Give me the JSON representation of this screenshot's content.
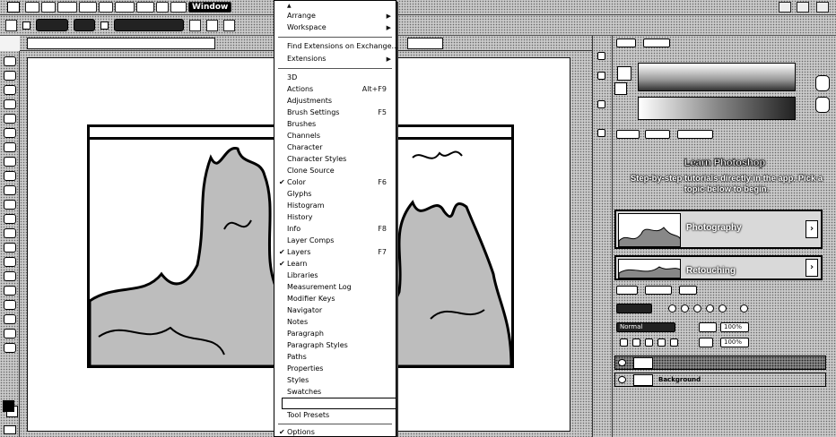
{
  "menubar": {
    "items": [
      "",
      "",
      "",
      "",
      "",
      "",
      "",
      ""
    ],
    "active": "Window"
  },
  "dropdown": {
    "items": [
      {
        "label": "Arrange",
        "submenu": true
      },
      {
        "label": "Workspace",
        "submenu": true
      },
      {
        "label": "Find Extensions on Exchange..."
      },
      {
        "label": "Extensions",
        "submenu": true
      },
      {
        "label": "3D"
      },
      {
        "label": "Actions",
        "shortcut": "Alt+F9"
      },
      {
        "label": "Adjustments"
      },
      {
        "label": "Brush Settings",
        "shortcut": "F5"
      },
      {
        "label": "Brushes"
      },
      {
        "label": "Channels"
      },
      {
        "label": "Character"
      },
      {
        "label": "Character Styles"
      },
      {
        "label": "Clone Source"
      },
      {
        "label": "Color",
        "shortcut": "F6",
        "checked": true
      },
      {
        "label": "Glyphs"
      },
      {
        "label": "Histogram"
      },
      {
        "label": "History"
      },
      {
        "label": "Info",
        "shortcut": "F8"
      },
      {
        "label": "Layer Comps"
      },
      {
        "label": "Layers",
        "shortcut": "F7",
        "checked": true
      },
      {
        "label": "Learn",
        "checked": true
      },
      {
        "label": "Libraries"
      },
      {
        "label": "Measurement Log"
      },
      {
        "label": "Modifier Keys"
      },
      {
        "label": "Navigator"
      },
      {
        "label": "Notes"
      },
      {
        "label": "Paragraph"
      },
      {
        "label": "Paragraph Styles"
      },
      {
        "label": "Paths"
      },
      {
        "label": "Properties"
      },
      {
        "label": "Styles"
      },
      {
        "label": "Swatches"
      },
      {
        "label": ""
      },
      {
        "label": "Tool Presets"
      },
      {
        "label": "Options",
        "checked": true
      }
    ]
  },
  "learn": {
    "title": "Learn Photoshop",
    "subtitle": "Step-by-step tutorials directly in the app. Pick a topic below to begin.",
    "tutorials": [
      {
        "label": "Photography"
      },
      {
        "label": "Retouching"
      }
    ]
  },
  "layers": {
    "blend_mode": "Normal",
    "opacity": "100%",
    "fill": "100%",
    "rows": [
      {
        "name": ""
      },
      {
        "name": "Background"
      }
    ]
  },
  "colors": {
    "ink": "#000000",
    "paper": "#ffffff"
  }
}
